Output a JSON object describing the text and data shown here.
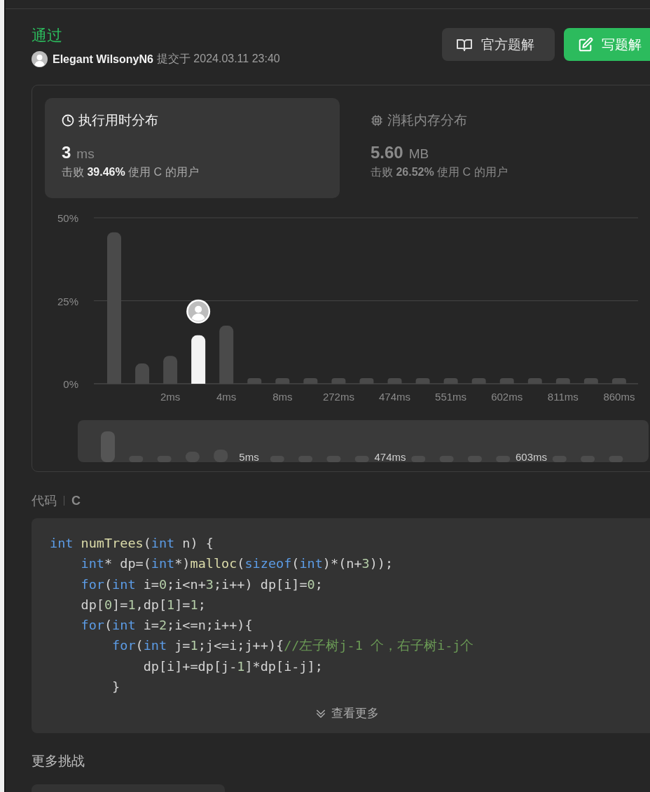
{
  "status": "通过",
  "submission": {
    "user": "Elegant WilsonyN6",
    "submitted_text": "提交于 2024.03.11 23:40"
  },
  "actions": [
    {
      "label": "官方题解",
      "kind": "solutions"
    },
    {
      "label": "写题解",
      "kind": "write"
    }
  ],
  "stats_tabs": [
    {
      "kind": "runtime",
      "title": "执行用时分布",
      "value": "3",
      "unit": "ms",
      "beats": "击败 **39.46%** 使用 C 的用户",
      "selected": true
    },
    {
      "kind": "memory",
      "title": "消耗内存分布",
      "value": "5.60",
      "unit": "MB",
      "beats": "击败 **26.52%** 使用 C 的用户",
      "selected": false
    }
  ],
  "chart": {
    "chart_data": {
      "type": "bar",
      "categories": [
        null,
        null,
        "2ms",
        null,
        "4ms",
        null,
        "8ms",
        null,
        "272ms",
        null,
        "474ms",
        null,
        "551ms",
        null,
        "602ms",
        null,
        "811ms",
        null,
        "860ms"
      ],
      "values": [
        45.6,
        6.1,
        8.4,
        14.6,
        17.5,
        1.7,
        1.7,
        1.7,
        1.7,
        1.7,
        1.7,
        1.7,
        1.7,
        1.7,
        1.7,
        1.7,
        1.7,
        1.7,
        1.7
      ],
      "ylim": [
        0,
        50
      ],
      "yticks": [
        {
          "value": 0,
          "label": "0%"
        },
        {
          "value": 25,
          "label": "25%"
        },
        {
          "value": 50,
          "label": "50%"
        }
      ]
    },
    "bars": [
      {
        "selected": false
      },
      {
        "selected": false
      },
      {
        "selected": false
      },
      {
        "selected": true
      },
      {
        "selected": false
      },
      {
        "selected": false
      },
      {
        "selected": false
      },
      {
        "selected": false
      },
      {
        "selected": false
      },
      {
        "selected": false
      },
      {
        "selected": false
      },
      {
        "selected": false
      },
      {
        "selected": false
      },
      {
        "selected": false
      },
      {
        "selected": false
      },
      {
        "selected": false
      },
      {
        "selected": false
      },
      {
        "selected": false
      },
      {
        "selected": false
      }
    ],
    "overview": {
      "labels": [
        "5ms",
        "474ms",
        "603ms"
      ]
    }
  },
  "code": {
    "label": "代码",
    "language": "C",
    "expand_label": "查看更多",
    "lines": [
      [
        {
          "t": "int",
          "kind": "keyword"
        },
        {
          "t": " numTrees",
          "kind": "function"
        },
        {
          "t": "(",
          "kind": "plain"
        },
        {
          "t": "int",
          "kind": "keyword"
        },
        {
          "t": " n) {",
          "kind": "plain"
        }
      ],
      [
        {
          "t": "    int",
          "kind": "keyword"
        },
        {
          "t": "* dp=(",
          "kind": "plain"
        },
        {
          "t": "int",
          "kind": "keyword"
        },
        {
          "t": "*)",
          "kind": "plain"
        },
        {
          "t": "malloc",
          "kind": "function"
        },
        {
          "t": "(",
          "kind": "plain"
        },
        {
          "t": "sizeof",
          "kind": "keyword"
        },
        {
          "t": "(",
          "kind": "plain"
        },
        {
          "t": "int",
          "kind": "keyword"
        },
        {
          "t": ")*(n+",
          "kind": "plain"
        },
        {
          "t": "3",
          "kind": "number"
        },
        {
          "t": "));",
          "kind": "plain"
        }
      ],
      [
        {
          "t": "    for",
          "kind": "keyword"
        },
        {
          "t": "(",
          "kind": "plain"
        },
        {
          "t": "int",
          "kind": "keyword"
        },
        {
          "t": " i=",
          "kind": "plain"
        },
        {
          "t": "0",
          "kind": "number"
        },
        {
          "t": ";i<n+",
          "kind": "plain"
        },
        {
          "t": "3",
          "kind": "number"
        },
        {
          "t": ";i++) dp[i]=",
          "kind": "plain"
        },
        {
          "t": "0",
          "kind": "number"
        },
        {
          "t": ";",
          "kind": "plain"
        }
      ],
      [
        {
          "t": "    dp[",
          "kind": "plain"
        },
        {
          "t": "0",
          "kind": "number"
        },
        {
          "t": "]=",
          "kind": "plain"
        },
        {
          "t": "1",
          "kind": "number"
        },
        {
          "t": ",dp[",
          "kind": "plain"
        },
        {
          "t": "1",
          "kind": "number"
        },
        {
          "t": "]=",
          "kind": "plain"
        },
        {
          "t": "1",
          "kind": "number"
        },
        {
          "t": ";",
          "kind": "plain"
        }
      ],
      [
        {
          "t": "    for",
          "kind": "keyword"
        },
        {
          "t": "(",
          "kind": "plain"
        },
        {
          "t": "int",
          "kind": "keyword"
        },
        {
          "t": " i=",
          "kind": "plain"
        },
        {
          "t": "2",
          "kind": "number"
        },
        {
          "t": ";i<=n;i++){",
          "kind": "plain"
        }
      ],
      [
        {
          "t": "        for",
          "kind": "keyword"
        },
        {
          "t": "(",
          "kind": "plain"
        },
        {
          "t": "int",
          "kind": "keyword"
        },
        {
          "t": " j=",
          "kind": "plain"
        },
        {
          "t": "1",
          "kind": "number"
        },
        {
          "t": ";j<=i;j++){",
          "kind": "plain"
        },
        {
          "t": "//左子树j-1 个，右子树i-j个",
          "kind": "comment"
        }
      ],
      [
        {
          "t": "            dp[i]+=dp[j-",
          "kind": "plain"
        },
        {
          "t": "1",
          "kind": "number"
        },
        {
          "t": "]*dp[i-j];",
          "kind": "plain"
        }
      ],
      [
        {
          "t": "        }",
          "kind": "plain"
        }
      ]
    ]
  },
  "more_challenges": {
    "title": "更多挑战"
  }
}
